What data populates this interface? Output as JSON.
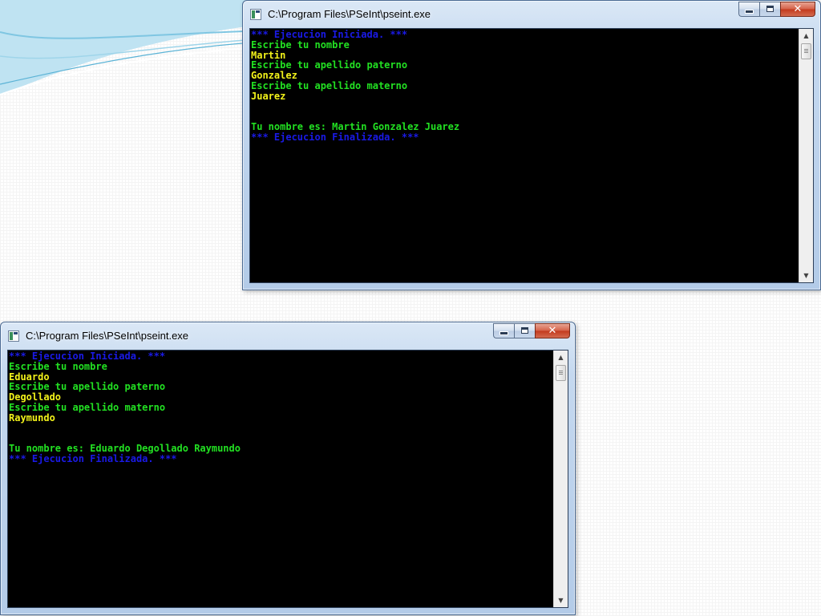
{
  "windows": [
    {
      "id": "top",
      "title": "C:\\Program Files\\PSeInt\\pseint.exe",
      "lines": [
        {
          "text": "*** Ejecucion Iniciada. ***",
          "color": "#1a1ae6"
        },
        {
          "text": "Escribe tu nombre",
          "color": "#22e022"
        },
        {
          "text": "Martin",
          "color": "#f2f21a"
        },
        {
          "text": "Escribe tu apellido paterno",
          "color": "#22e022"
        },
        {
          "text": "Gonzalez",
          "color": "#f2f21a"
        },
        {
          "text": "Escribe tu apellido materno",
          "color": "#22e022"
        },
        {
          "text": "Juarez",
          "color": "#f2f21a"
        },
        {
          "text": "",
          "color": "#22e022"
        },
        {
          "text": "",
          "color": "#22e022"
        },
        {
          "text": "Tu nombre es: Martin Gonzalez Juarez",
          "color": "#22e022"
        },
        {
          "text": "*** Ejecucion Finalizada. ***",
          "color": "#1a1ae6"
        }
      ]
    },
    {
      "id": "bottom",
      "title": "C:\\Program Files\\PSeInt\\pseint.exe",
      "lines": [
        {
          "text": "*** Ejecucion Iniciada. ***",
          "color": "#1a1ae6"
        },
        {
          "text": "Escribe tu nombre",
          "color": "#22e022"
        },
        {
          "text": "Eduardo",
          "color": "#f2f21a"
        },
        {
          "text": "Escribe tu apellido paterno",
          "color": "#22e022"
        },
        {
          "text": "Degollado",
          "color": "#f2f21a"
        },
        {
          "text": "Escribe tu apellido materno",
          "color": "#22e022"
        },
        {
          "text": "Raymundo",
          "color": "#f2f21a"
        },
        {
          "text": "",
          "color": "#22e022"
        },
        {
          "text": "",
          "color": "#22e022"
        },
        {
          "text": "Tu nombre es: Eduardo Degollado Raymundo",
          "color": "#22e022"
        },
        {
          "text": "*** Ejecucion Finalizada. ***",
          "color": "#1a1ae6"
        }
      ]
    }
  ],
  "icons": {
    "app": "console-app-icon",
    "minimize": "minimize-icon",
    "maximize": "maximize-icon",
    "close": "close-icon",
    "scroll_up": "scroll-up-arrow-icon",
    "scroll_down": "scroll-down-arrow-icon"
  },
  "glyphs": {
    "close": "✕",
    "scroll_up": "▲",
    "scroll_down": "▼"
  },
  "colors": {
    "console_bg": "#000000",
    "system_message": "#1a1ae6",
    "prompt_output": "#22e022",
    "user_input": "#f2f21a"
  }
}
